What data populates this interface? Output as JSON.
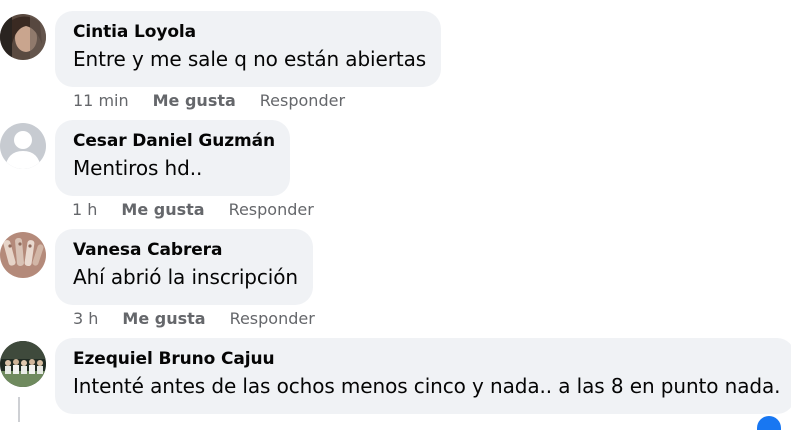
{
  "comments": [
    {
      "author": "Cintia Loyola",
      "text": "Entre y me sale q no están abiertas",
      "time": "11 min",
      "like_label": "Me gusta",
      "reply_label": "Responder"
    },
    {
      "author": "Cesar Daniel Guzmán",
      "text": "Mentiros hd..",
      "time": "1 h",
      "like_label": "Me gusta",
      "reply_label": "Responder"
    },
    {
      "author": "Vanesa Cabrera",
      "text": "Ahí abrió la inscripción",
      "time": "3 h",
      "like_label": "Me gusta",
      "reply_label": "Responder"
    },
    {
      "author": "Ezequiel Bruno Cajuu",
      "text": "Intenté antes de las ochos menos cinco y nada.. a las 8 en punto nada."
    }
  ],
  "colors": {
    "bubble_bg": "#f0f2f5",
    "meta_text": "#65676b",
    "accent": "#1877f2"
  }
}
